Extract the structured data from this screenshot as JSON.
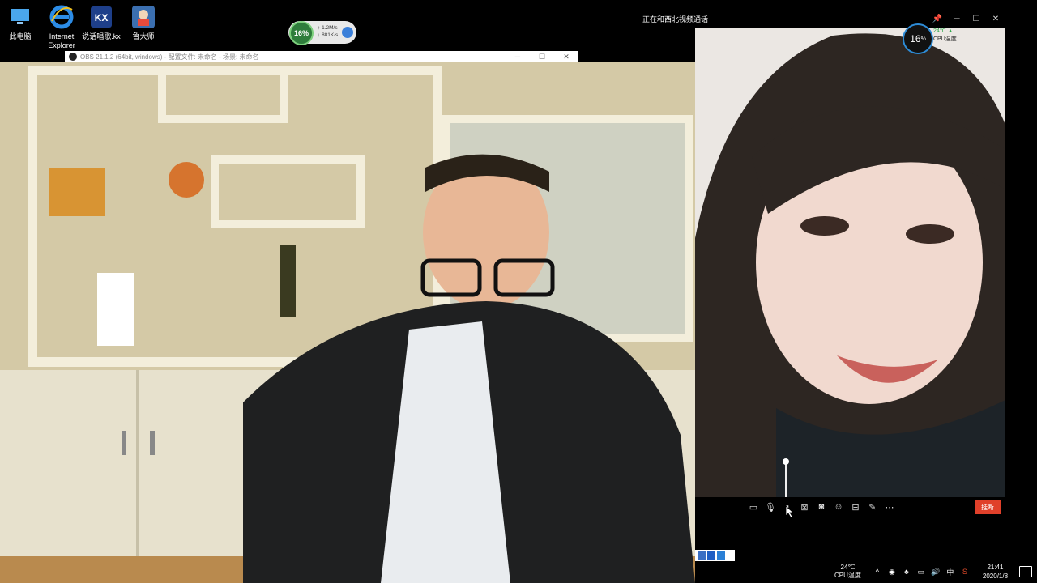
{
  "desktop_icons": [
    {
      "label": "此电脑",
      "icon": "computer-icon"
    },
    {
      "label": "Internet Explorer",
      "icon": "internet-explorer-icon"
    },
    {
      "label": "说话唱歌.kx",
      "icon": "kx-app-icon"
    },
    {
      "label": "鲁大师",
      "icon": "ludashi-icon"
    }
  ],
  "widget": {
    "cpu": "16%",
    "up": "1.2M/s",
    "down": "881K/s"
  },
  "obs": {
    "title": "OBS 21.1.2 (64bit, windows) - 配置文件: 未命名 - 场景: 未命名"
  },
  "call": {
    "title": "正在和西北视频通话",
    "cpu_badge": "16",
    "cpu_badge_unit": "%",
    "cpu_temp": "24℃",
    "cpu_temp_label": "CPU温度",
    "hangup": "挂断",
    "volume": 1.0,
    "toolbar_icons": [
      "chat-icon",
      "microphone-icon",
      "speaker-icon",
      "camera-off-icon",
      "screenshot-icon",
      "effects-icon",
      "layout-icon",
      "edit-icon",
      "more-icon"
    ]
  },
  "taskbar": {
    "temp": "24℃",
    "temp_label": "CPU温度",
    "ime": "中",
    "time": "21:41",
    "date": "2020/1/8"
  },
  "colors": {
    "hangup": "#e0402a",
    "widget_green": "#2f7d3c",
    "badge_blue": "#2d8bd6"
  }
}
